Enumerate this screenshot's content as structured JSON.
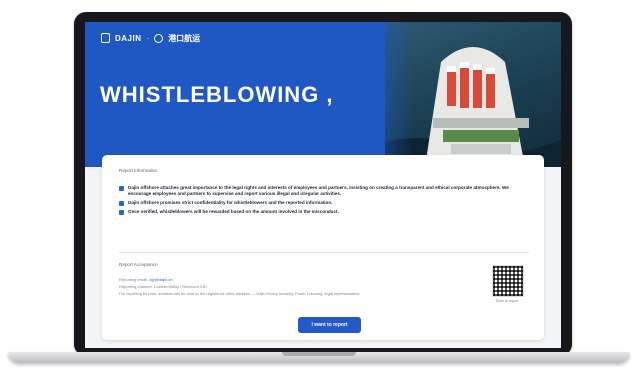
{
  "brand": {
    "name": "DAJIN",
    "separator": "·",
    "partner": "港口航运"
  },
  "hero": {
    "title": "WHISTLEBLOWING ,"
  },
  "report_info": {
    "section_title": "Report Information",
    "bullets": [
      "Dajin offshore attaches great importance to the legal rights and interests of employees and partners, insisting on creating a transparent and ethical corporate atmosphere. We encourage employees and partners to supervise and report various illegal and irregular activities.",
      "Dajin offshore promises strict confidentiality for whistleblowers and the reported information.",
      "Once verified, whistleblowers will be rewarded based on the amount involved in the misconduct."
    ]
  },
  "contact": {
    "section_title": "Report Acceptance",
    "email_label": "Reporting email:",
    "email_value": "zgr@dajin.cn",
    "hours_line": "Reporting channel: Confidentiality / Received 24h",
    "note_line": "For reporting by post, address can be sent to the registered office address — Dajin Heavy Industry, Fuxin, Liaoning; legal representative.",
    "qr_caption": "Scan to report"
  },
  "cta": {
    "label": "I want to report"
  },
  "colors": {
    "primary": "#2459c9",
    "hero_blue": "#1f57c3",
    "bullet_accent": "#2563eb"
  }
}
